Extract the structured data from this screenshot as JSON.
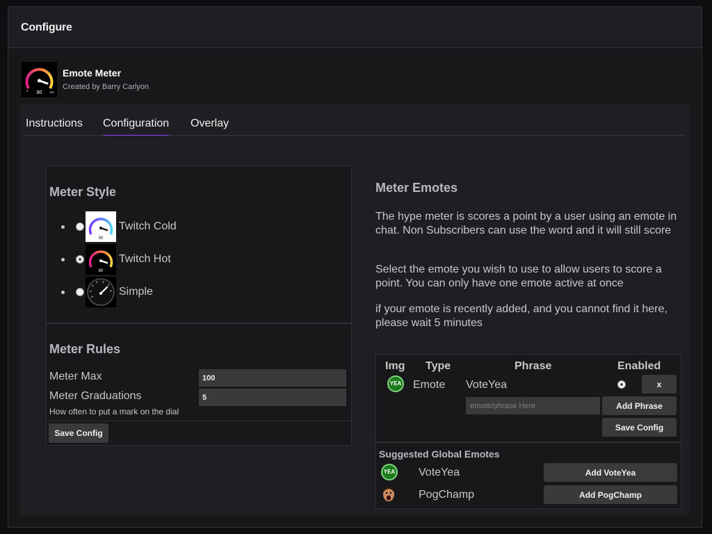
{
  "window": {
    "title": "Configure"
  },
  "extension": {
    "name": "Emote Meter",
    "author": "Created by Barry Carlyon"
  },
  "tabs": [
    {
      "label": "Instructions",
      "active": false
    },
    {
      "label": "Configuration",
      "active": true
    },
    {
      "label": "Overlay",
      "active": false
    }
  ],
  "meter_style": {
    "title": "Meter Style",
    "options": [
      {
        "label": "Twitch Cold",
        "selected": false,
        "icon": "gauge-cold-icon"
      },
      {
        "label": "Twitch Hot",
        "selected": true,
        "icon": "gauge-hot-icon"
      },
      {
        "label": "Simple",
        "selected": false,
        "icon": "gauge-simple-icon"
      }
    ]
  },
  "meter_rules": {
    "title": "Meter Rules",
    "max_label": "Meter Max",
    "max_value": "100",
    "graduations_label": "Meter Graduations",
    "graduations_value": "5",
    "graduations_help": "How often to put a mark on the dial"
  },
  "save_config_label": "Save Config",
  "meter_emotes": {
    "title": "Meter Emotes",
    "paragraphs": [
      "The hype meter is scores a point by a user using an emote in chat. Non Subscribers can use the word and it will still score",
      "Select the emote you wish to use to allow users to score a point. You can only have one emote active at once",
      "if your emote is recently added, and you cannot find it here, please wait 5 minutes"
    ],
    "table": {
      "headers": {
        "img": "Img",
        "type": "Type",
        "phrase": "Phrase",
        "enabled": "Enabled"
      },
      "row": {
        "badge": "YEA",
        "type": "Emote",
        "phrase": "VoteYea",
        "enabled": true,
        "remove_label": "x"
      },
      "phrase_placeholder": "emote/phrase Here",
      "add_phrase_label": "Add Phrase",
      "save_config_label": "Save Config"
    },
    "suggested": {
      "title": "Suggested Global Emotes",
      "items": [
        {
          "name": "VoteYea",
          "badge": "YEA",
          "button": "Add VoteYea"
        },
        {
          "name": "PogChamp",
          "button": "Add PogChamp"
        }
      ]
    }
  },
  "colors": {
    "accent": "#9147ff",
    "background": "#18181b",
    "panel": "#1f1f23",
    "input": "#3a3a3d"
  }
}
